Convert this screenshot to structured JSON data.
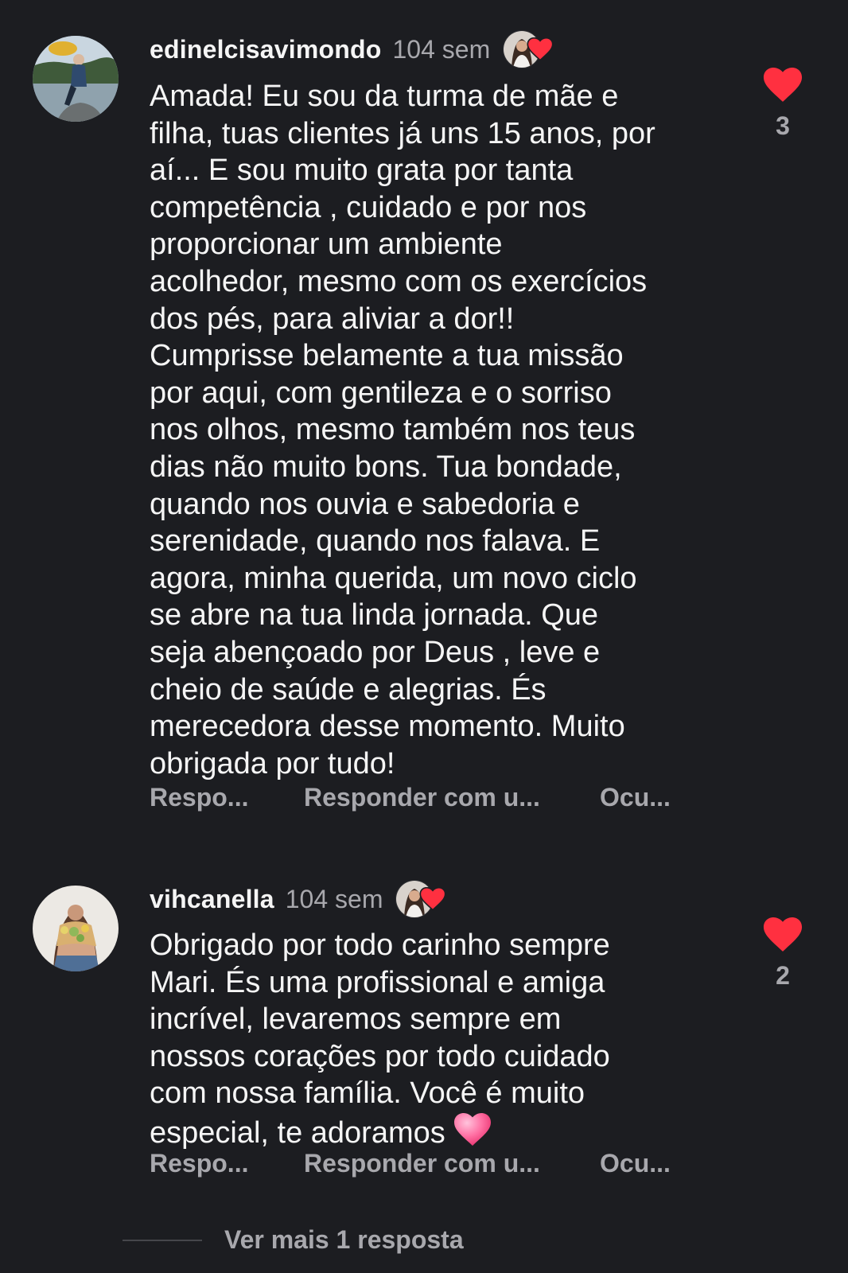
{
  "comments": [
    {
      "username": "edinelcisavimondo",
      "time": "104 sem",
      "text": "Amada!  Eu sou da turma de mãe e\nfilha, tuas clientes já uns 15 anos, por\naí... E sou muito grata por tanta\ncompetência , cuidado e por nos\nproporcionar um ambiente\nacolhedor, mesmo com os exercícios\ndos pés, para aliviar a dor!!\nCumprisse belamente a tua missão\npor aqui,  com gentileza e o sorriso\nnos olhos, mesmo também nos teus\ndias não muito bons. Tua bondade,\nquando nos ouvia e sabedoria e\nserenidade, quando nos falava. E\nagora, minha querida, um novo ciclo\nse abre na tua linda jornada. Que\nseja abençoado por Deus , leve e\ncheio de saúde e alegrias. És\nmerecedora desse momento. Muito\nobrigada por tudo!",
      "text_emoji": "",
      "like_count": "3",
      "actions": {
        "reply": "Respo...",
        "reply_with": "Responder com u...",
        "hide": "Ocu..."
      }
    },
    {
      "username": "vihcanella",
      "time": "104 sem",
      "text": "Obrigado por todo carinho sempre\nMari. És uma profissional e amiga\nincrível, levaremos sempre em\nnossos corações por todo cuidado\ncom nossa família. Você é muito\nespecial, te adoramos ",
      "text_emoji": "pink-heart",
      "like_count": "2",
      "actions": {
        "reply": "Respo...",
        "reply_with": "Responder com u...",
        "hide": "Ocu..."
      }
    }
  ],
  "more_replies": "Ver mais 1 resposta",
  "colors": {
    "background": "#1c1d21",
    "text": "#f5f5f5",
    "secondary": "#a8a8ad",
    "heart": "#ff3040",
    "emoji_heart": "#ff6fa3"
  },
  "icons": {
    "like": "heart-filled-icon",
    "author_like": "creator-liked-heart-icon"
  }
}
